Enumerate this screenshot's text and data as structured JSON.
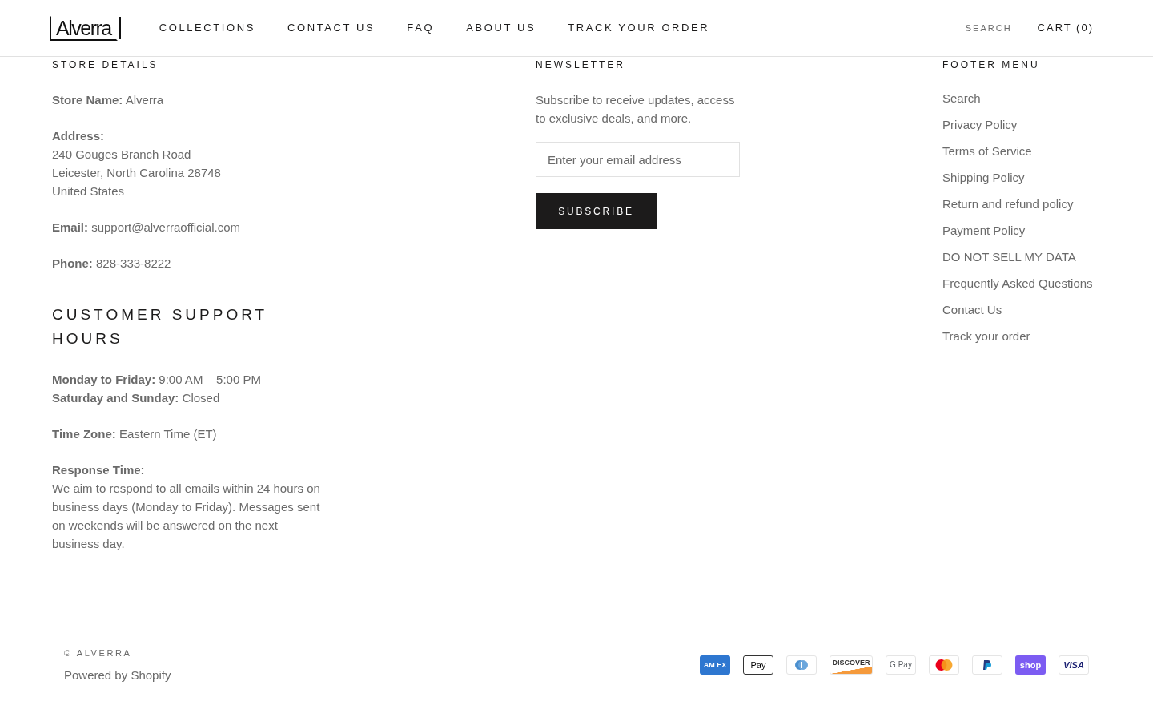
{
  "header": {
    "logo": "Alverra",
    "nav": [
      {
        "label": "COLLECTIONS"
      },
      {
        "label": "CONTACT US"
      },
      {
        "label": "FAQ"
      },
      {
        "label": "ABOUT US"
      },
      {
        "label": "TRACK YOUR ORDER"
      }
    ],
    "search": "SEARCH",
    "cart": "CART (0)"
  },
  "store_details": {
    "heading": "STORE DETAILS",
    "paragraphs": [
      {
        "lines": [
          "**Store Name:** Alverra"
        ]
      },
      {
        "lines": [
          "**Address:**",
          "240 Gouges Branch Road",
          "Leicester, North Carolina 28748",
          "United States"
        ]
      },
      {
        "lines": [
          "**Email:** support@alverraofficial.com"
        ]
      },
      {
        "lines": [
          "**Phone:** 828-333-8222"
        ]
      }
    ],
    "support_heading": "CUSTOMER SUPPORT HOURS",
    "support_paragraphs": [
      {
        "lines": [
          "**Monday to Friday:** 9:00 AM – 5:00 PM",
          "**Saturday and Sunday:** Closed"
        ]
      },
      {
        "lines": [
          "**Time Zone:** Eastern Time (ET)"
        ]
      },
      {
        "lines": [
          "**Response Time:**",
          "We aim to respond to all emails within 24 hours on business days (Monday to Friday). Messages sent on weekends will be answered on the next business day."
        ]
      }
    ]
  },
  "newsletter": {
    "heading": "NEWSLETTER",
    "text": "Subscribe to receive updates, access to exclusive deals, and more.",
    "placeholder": "Enter your email address",
    "button": "SUBSCRIBE"
  },
  "footer_menu": {
    "heading": "FOOTER MENU",
    "items": [
      "Search",
      "Privacy Policy",
      "Terms of Service",
      "Shipping Policy",
      "Return and refund policy",
      "Payment Policy",
      "DO NOT SELL MY DATA",
      "Frequently Asked Questions",
      "Contact Us",
      "Track your order"
    ]
  },
  "bottom": {
    "copyright": "© ALVERRA",
    "powered": "Powered by Shopify"
  },
  "payments": [
    {
      "kind": "amex",
      "label": "AM EX"
    },
    {
      "kind": "applepay",
      "label": "Pay"
    },
    {
      "kind": "diners"
    },
    {
      "kind": "discover",
      "label": "DISCOVER"
    },
    {
      "kind": "gpay",
      "label": "G Pay"
    },
    {
      "kind": "mastercard"
    },
    {
      "kind": "paypal"
    },
    {
      "kind": "shop",
      "label": "shop"
    },
    {
      "kind": "visa",
      "label": "VISA"
    }
  ]
}
